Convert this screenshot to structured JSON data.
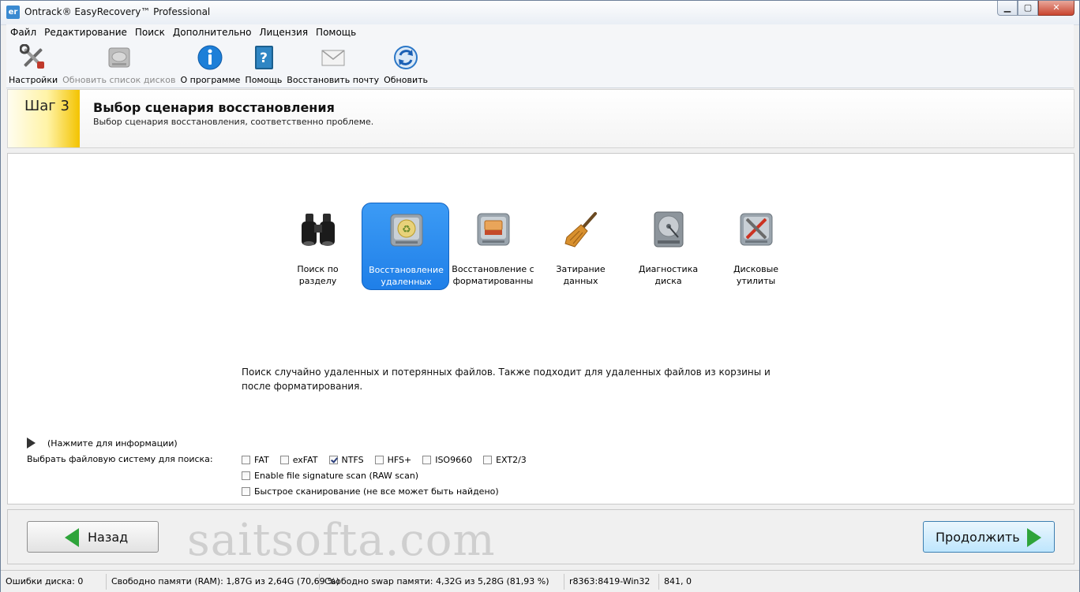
{
  "window": {
    "title": "Ontrack® EasyRecovery™ Professional",
    "app_icon": "er",
    "close_glyph": "✕",
    "min_glyph": "▁",
    "max_glyph": "▢"
  },
  "menu": [
    "Файл",
    "Редактирование",
    "Поиск",
    "Дополнительно",
    "Лицензия",
    "Помощь"
  ],
  "toolbar": [
    {
      "label": "Настройки",
      "icon": "tools-icon",
      "disabled": false
    },
    {
      "label": "Обновить список дисков",
      "icon": "disk-refresh-icon",
      "disabled": true
    },
    {
      "label": "О программе",
      "icon": "info-icon",
      "disabled": false
    },
    {
      "label": "Помощь",
      "icon": "help-book-icon",
      "disabled": false
    },
    {
      "label": "Восстановить почту",
      "icon": "mail-icon",
      "disabled": false
    },
    {
      "label": "Обновить",
      "icon": "update-icon",
      "disabled": false
    }
  ],
  "header": {
    "step": "Шаг 3",
    "title": "Выбор сценария восстановления",
    "subtitle": "Выбор сценария восстановления, соответственно проблеме."
  },
  "scenarios": [
    {
      "line1": "Поиск по",
      "line2": "разделу",
      "icon": "binoculars-icon",
      "selected": false
    },
    {
      "line1": "Восстановление",
      "line2": "удаленных",
      "icon": "recycle-drive-icon",
      "selected": true
    },
    {
      "line1": "Восстановление с",
      "line2": "форматированны",
      "icon": "format-drive-icon",
      "selected": false
    },
    {
      "line1": "Затирание",
      "line2": "данных",
      "icon": "broom-icon",
      "selected": false
    },
    {
      "line1": "Диагностика",
      "line2": "диска",
      "icon": "hdd-diagnostic-icon",
      "selected": false
    },
    {
      "line1": "Дисковые",
      "line2": "утилиты",
      "icon": "disk-tools-icon",
      "selected": false
    }
  ],
  "description": "Поиск случайно удаленных и потерянных файлов. Также подходит для удаленных файлов из корзины и после форматирования.",
  "info_toggle": "(Нажмите для информации)",
  "fs_label": "Выбрать файловую систему для поиска:",
  "filesystems": [
    {
      "label": "FAT",
      "checked": false
    },
    {
      "label": "exFAT",
      "checked": false
    },
    {
      "label": "NTFS",
      "checked": true
    },
    {
      "label": "HFS+",
      "checked": false
    },
    {
      "label": "ISO9660",
      "checked": false
    },
    {
      "label": "EXT2/3",
      "checked": false
    }
  ],
  "options": {
    "raw_scan": {
      "label": "Enable file signature scan (RAW scan)",
      "checked": false
    },
    "quick_scan": {
      "label": "Быстрое сканирование (не все может быть найдено)",
      "checked": false
    }
  },
  "nav": {
    "back": "Назад",
    "next": "Продолжить"
  },
  "watermark": "saitsofta.com",
  "status": [
    "Ошибки диска: 0",
    "Свободно памяти (RAM): 1,87G из 2,64G (70,69 %)",
    "Свободно swap памяти: 4,32G из 5,28G (81,93 %)",
    "r8363:8419-Win32",
    "841, 0"
  ],
  "colors": {
    "accent": "#2a8bef",
    "nav_arrow": "#2ea43a",
    "step_badge": "#f3c300"
  }
}
